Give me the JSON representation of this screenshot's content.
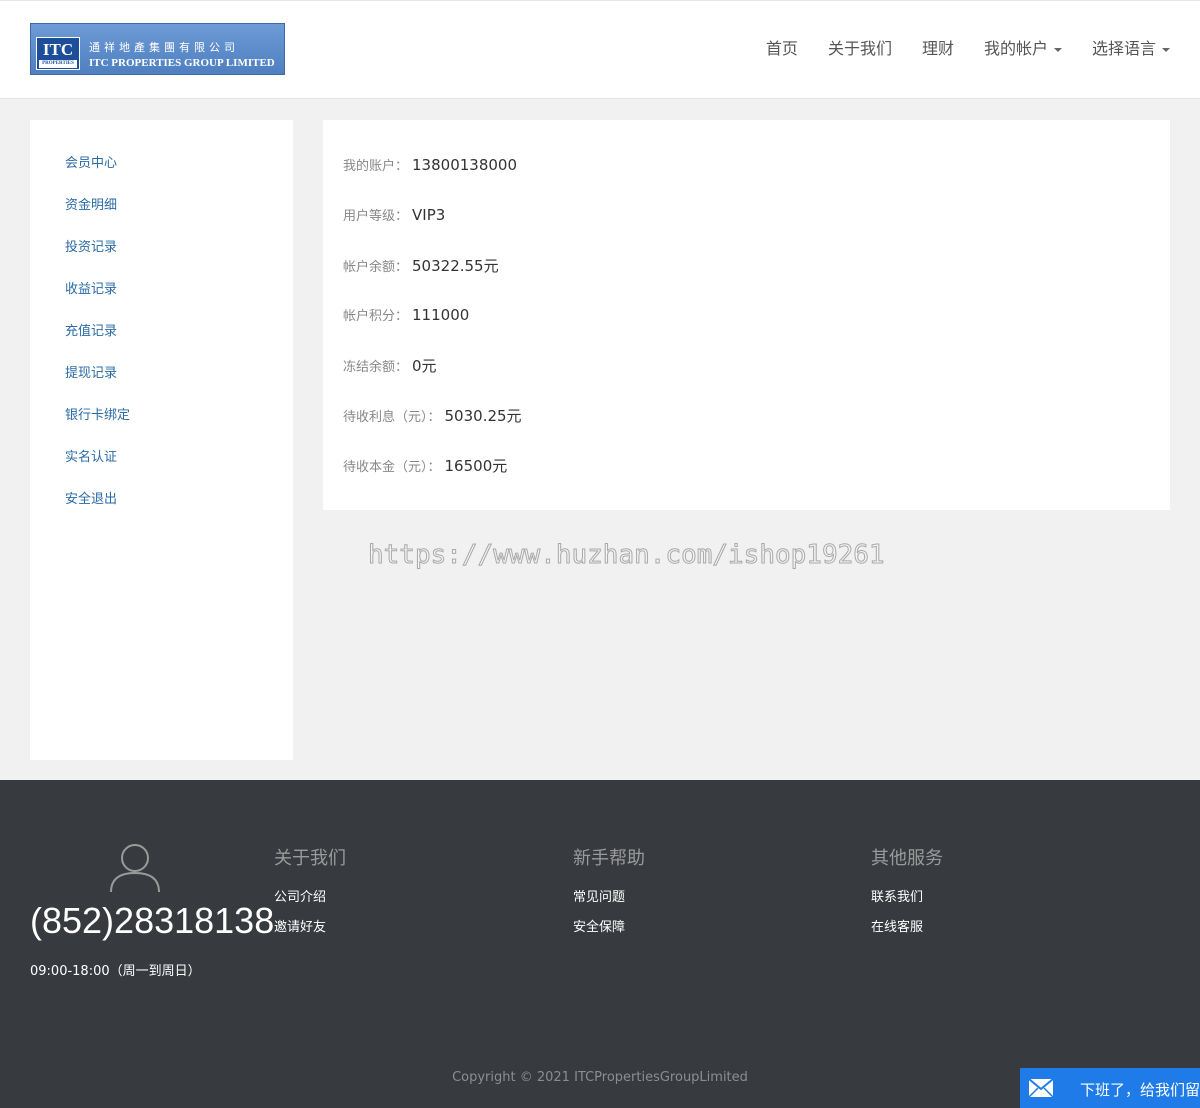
{
  "brand": {
    "badge": "ITC",
    "badge_sub": "PROPERTIES",
    "name_cn": "通祥地產集團有限公司",
    "name_en": "ITC PROPERTIES GROUP LIMITED"
  },
  "nav": {
    "home": "首页",
    "about": "关于我们",
    "finance": "理财",
    "account": "我的帐户",
    "language": "选择语言"
  },
  "sidebar": {
    "items": [
      {
        "label": "会员中心"
      },
      {
        "label": "资金明细"
      },
      {
        "label": "投资记录"
      },
      {
        "label": "收益记录"
      },
      {
        "label": "充值记录"
      },
      {
        "label": "提现记录"
      },
      {
        "label": "银行卡绑定"
      },
      {
        "label": "实名认证"
      },
      {
        "label": "安全退出"
      }
    ]
  },
  "account": {
    "rows": [
      {
        "label": "我的账户：",
        "value": "13800138000"
      },
      {
        "label": "用户等级：",
        "value": "VIP3"
      },
      {
        "label": "帐户余额：",
        "value": "50322.55元"
      },
      {
        "label": "帐户积分：",
        "value": "111000"
      },
      {
        "label": "冻结余额：",
        "value": "0元"
      },
      {
        "label": "待收利息（元）：",
        "value": "5030.25元"
      },
      {
        "label": "待收本金（元）：",
        "value": "16500元"
      }
    ]
  },
  "watermark": "https://www.huzhan.com/ishop19261",
  "footer": {
    "phone": "(852)28318138",
    "hours": "09:00-18:00（周一到周日）",
    "col1": {
      "title": "关于我们",
      "links": [
        "公司介绍",
        "邀请好友"
      ]
    },
    "col2": {
      "title": "新手帮助",
      "links": [
        "常见问题",
        "安全保障"
      ]
    },
    "col3": {
      "title": "其他服务",
      "links": [
        "联系我们",
        "在线客服"
      ]
    },
    "copyright": "Copyright © 2021 ITCPropertiesGroupLimited"
  },
  "chat": {
    "label": "下班了，给我们留言"
  },
  "colors": {
    "accent": "#2a6aa5",
    "footer_bg": "#373a3e",
    "chat_bg": "#1e7be8"
  }
}
